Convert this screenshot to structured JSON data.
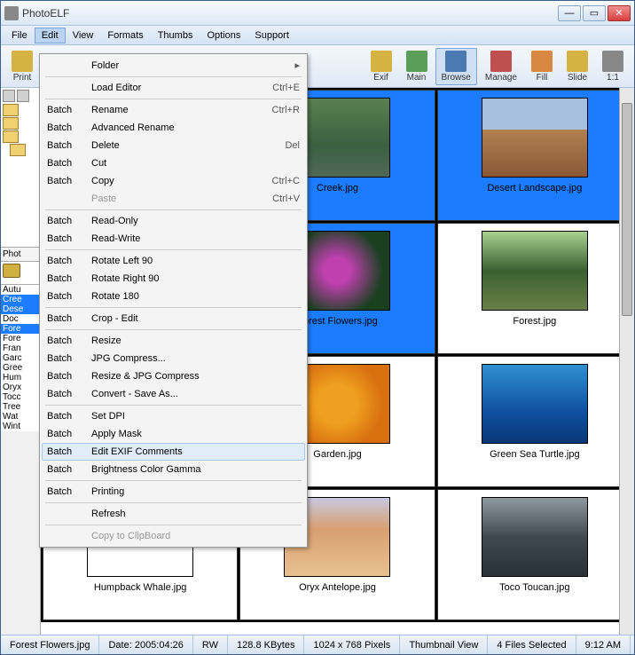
{
  "title": "PhotoELF",
  "menubar": [
    "File",
    "Edit",
    "View",
    "Formats",
    "Thumbs",
    "Options",
    "Support"
  ],
  "active_menu_index": 1,
  "toolbar_left": [
    {
      "label": "Print",
      "cls": "yellow"
    }
  ],
  "toolbar_right": [
    {
      "label": "Exif",
      "cls": "yellow"
    },
    {
      "label": "Main",
      "cls": "green"
    },
    {
      "label": "Browse",
      "cls": "blue",
      "selected": true
    },
    {
      "label": "Manage",
      "cls": "red"
    },
    {
      "label": "Fill",
      "cls": "orange"
    },
    {
      "label": "Slide",
      "cls": "yellow"
    },
    {
      "label": "1:1",
      "cls": ""
    }
  ],
  "left_tab": "Phot",
  "file_list": [
    {
      "name": "Autu",
      "sel": false
    },
    {
      "name": "Cree",
      "sel": true
    },
    {
      "name": "Dese",
      "sel": true
    },
    {
      "name": "Doc",
      "sel": false
    },
    {
      "name": "Fore",
      "sel": true
    },
    {
      "name": "Fore",
      "sel": false
    },
    {
      "name": "Fran",
      "sel": false
    },
    {
      "name": "Garc",
      "sel": false
    },
    {
      "name": "Gree",
      "sel": false
    },
    {
      "name": "Hum",
      "sel": false
    },
    {
      "name": "Oryx",
      "sel": false
    },
    {
      "name": "Tocc",
      "sel": false
    },
    {
      "name": "Tree",
      "sel": false
    },
    {
      "name": "Wat",
      "sel": false
    },
    {
      "name": "Wint",
      "sel": false
    }
  ],
  "edit_menu": [
    {
      "c1": "",
      "c2": "Folder",
      "c3": "",
      "arrow": true
    },
    {
      "sep": true
    },
    {
      "c1": "",
      "c2": "Load Editor",
      "c3": "Ctrl+E"
    },
    {
      "sep": true
    },
    {
      "c1": "Batch",
      "c2": "Rename",
      "c3": "Ctrl+R"
    },
    {
      "c1": "Batch",
      "c2": "Advanced Rename",
      "c3": ""
    },
    {
      "c1": "Batch",
      "c2": "Delete",
      "c3": "Del"
    },
    {
      "c1": "Batch",
      "c2": "Cut",
      "c3": ""
    },
    {
      "c1": "Batch",
      "c2": "Copy",
      "c3": "Ctrl+C"
    },
    {
      "c1": "",
      "c2": "Paste",
      "c3": "Ctrl+V",
      "disabled": true
    },
    {
      "sep": true
    },
    {
      "c1": "Batch",
      "c2": "Read-Only",
      "c3": ""
    },
    {
      "c1": "Batch",
      "c2": "Read-Write",
      "c3": ""
    },
    {
      "sep": true
    },
    {
      "c1": "Batch",
      "c2": "Rotate Left 90",
      "c3": ""
    },
    {
      "c1": "Batch",
      "c2": "Rotate Right 90",
      "c3": ""
    },
    {
      "c1": "Batch",
      "c2": "Rotate 180",
      "c3": ""
    },
    {
      "sep": true
    },
    {
      "c1": "Batch",
      "c2": "Crop - Edit",
      "c3": ""
    },
    {
      "sep": true
    },
    {
      "c1": "Batch",
      "c2": "Resize",
      "c3": ""
    },
    {
      "c1": "Batch",
      "c2": "JPG Compress...",
      "c3": ""
    },
    {
      "c1": "Batch",
      "c2": "Resize & JPG Compress",
      "c3": ""
    },
    {
      "c1": "Batch",
      "c2": "Convert - Save As...",
      "c3": ""
    },
    {
      "sep": true
    },
    {
      "c1": "Batch",
      "c2": "Set DPI",
      "c3": ""
    },
    {
      "c1": "Batch",
      "c2": "Apply Mask",
      "c3": ""
    },
    {
      "c1": "Batch",
      "c2": "Edit EXIF Comments",
      "c3": "",
      "hover": true
    },
    {
      "c1": "Batch",
      "c2": "Brightness Color Gamma",
      "c3": ""
    },
    {
      "sep": true
    },
    {
      "c1": "Batch",
      "c2": "Printing",
      "c3": ""
    },
    {
      "sep": true
    },
    {
      "c1": "",
      "c2": "Refresh",
      "c3": ""
    },
    {
      "sep": true
    },
    {
      "c1": "",
      "c2": "Copy to ClipBoard",
      "c3": "",
      "disabled": true
    }
  ],
  "thumbnails": [
    {
      "name": "",
      "cls": "whale",
      "selected": true,
      "hidden": true
    },
    {
      "name": "Creek.jpg",
      "cls": "creek",
      "selected": true
    },
    {
      "name": "Desert Landscape.jpg",
      "cls": "desert",
      "selected": true
    },
    {
      "name": "",
      "cls": "whale",
      "selected": true,
      "hidden": true
    },
    {
      "name": "Forest Flowers.jpg",
      "cls": "flowers",
      "selected": true
    },
    {
      "name": "Forest.jpg",
      "cls": "forest",
      "selected": false
    },
    {
      "name": "",
      "cls": "whale",
      "selected": false,
      "hidden": true
    },
    {
      "name": "Garden.jpg",
      "cls": "garden",
      "selected": false
    },
    {
      "name": "Green Sea Turtle.jpg",
      "cls": "turtle",
      "selected": false
    },
    {
      "name": "Humpback Whale.jpg",
      "cls": "whale",
      "selected": false,
      "partial": true
    },
    {
      "name": "Oryx Antelope.jpg",
      "cls": "oryx",
      "selected": false
    },
    {
      "name": "Toco Toucan.jpg",
      "cls": "toucan",
      "selected": false
    }
  ],
  "statusbar": [
    "Forest Flowers.jpg",
    "Date: 2005:04:26",
    "RW",
    "128.8 KBytes",
    "1024 x 768 Pixels",
    "Thumbnail View",
    "4 Files Selected",
    "9:12 AM"
  ]
}
